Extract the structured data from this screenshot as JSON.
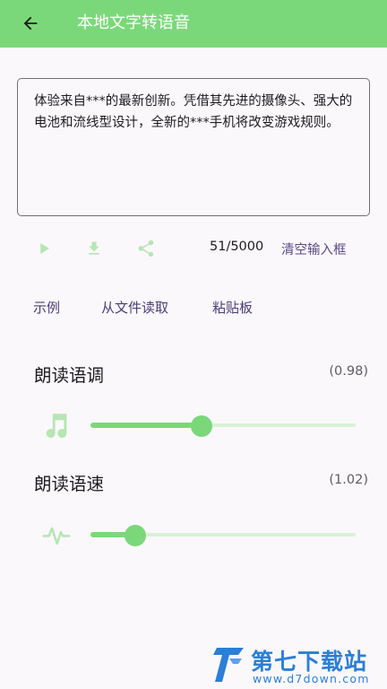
{
  "appbar": {
    "title": "本地文字转语音",
    "back_icon": "arrow-left-icon",
    "background": "#7bd87a"
  },
  "input": {
    "text": "体验来自***的最新创新。凭借其先进的摄像头、强大的电池和流线型设计，全新的***手机将改变游戏规则。"
  },
  "actions": {
    "play_icon": "play-icon",
    "download_icon": "download-icon",
    "share_icon": "share-icon",
    "counter": "51/5000",
    "clear_label": "清空输入框"
  },
  "sources": {
    "example_label": "示例",
    "file_label": "从文件读取",
    "clipboard_label": "粘贴板"
  },
  "pitch": {
    "title": "朗读语调",
    "value_text": "(0.98)",
    "icon": "music-note-icon",
    "level": 0.42
  },
  "rate": {
    "title": "朗读语速",
    "value_text": "(1.02)",
    "icon": "waveform-icon",
    "level": 0.17
  },
  "watermark": {
    "name": "第七下载站",
    "url": "www.d7down.com"
  },
  "colors": {
    "accent": "#7bd87a",
    "accent_light": "#d8f2d6",
    "link": "#4b3d75"
  }
}
